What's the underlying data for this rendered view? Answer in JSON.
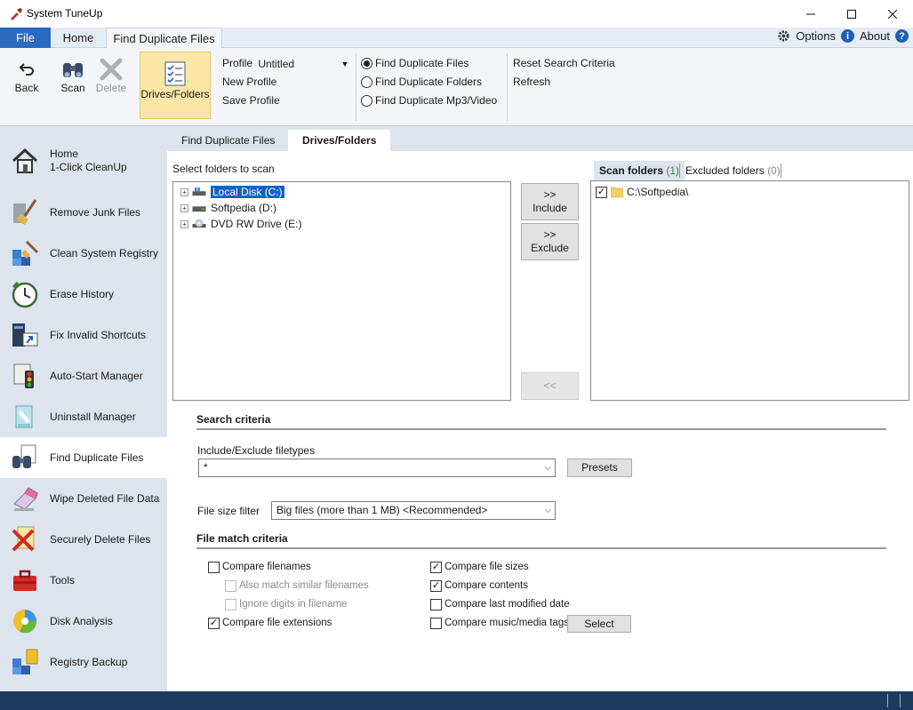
{
  "window": {
    "title": "System TuneUp"
  },
  "menu": {
    "file": "File",
    "home": "Home",
    "active_tab": "Find Duplicate Files",
    "options": "Options",
    "about": "About"
  },
  "ribbon": {
    "back": "Back",
    "scan": "Scan",
    "delete": "Delete",
    "drives_folders": "Drives/Folders",
    "profile_label": "Profile",
    "profile_value": "Untitled",
    "new_profile": "New Profile",
    "save_profile": "Save Profile",
    "radio_options": [
      "Find Duplicate Files",
      "Find Duplicate Folders",
      "Find Duplicate Mp3/Video"
    ],
    "reset": "Reset Search Criteria",
    "refresh": "Refresh"
  },
  "sidebar": {
    "items": [
      {
        "label": "Home",
        "label2": "1-Click CleanUp"
      },
      {
        "label": "Remove Junk Files"
      },
      {
        "label": "Clean System Registry"
      },
      {
        "label": "Erase History"
      },
      {
        "label": "Fix Invalid Shortcuts"
      },
      {
        "label": "Auto-Start Manager"
      },
      {
        "label": "Uninstall Manager"
      },
      {
        "label": "Find Duplicate Files"
      },
      {
        "label": "Wipe Deleted File Data"
      },
      {
        "label": "Securely Delete Files"
      },
      {
        "label": "Tools"
      },
      {
        "label": "Disk Analysis"
      },
      {
        "label": "Registry Backup"
      }
    ]
  },
  "subtabs": [
    "Find Duplicate Files",
    "Drives/Folders"
  ],
  "folders": {
    "select_label": "Select folders to scan",
    "tree": [
      "Local Disk (C:)",
      "Softpedia (D:)",
      "DVD RW Drive (E:)"
    ],
    "include_arrows": ">>",
    "include": "Include",
    "exclude_arrows": ">>",
    "exclude": "Exclude",
    "remove": "<<",
    "scan_tab": "Scan folders",
    "scan_count": "(1)",
    "excluded_tab": "Excluded folders",
    "excluded_count": "(0)",
    "scan_list": [
      "C:\\Softpedia\\"
    ]
  },
  "search": {
    "title": "Search criteria",
    "filetypes_label": "Include/Exclude filetypes",
    "filetypes_value": "*",
    "presets": "Presets",
    "size_label": "File size filter",
    "size_value": "Big files (more than 1 MB) <Recommended>"
  },
  "match": {
    "title": "File match criteria",
    "compare_filenames": "Compare filenames",
    "similar_filenames": "Also match similar filenames",
    "ignore_digits": "Ignore digits in filename",
    "compare_extensions": "Compare file extensions",
    "compare_sizes": "Compare file sizes",
    "compare_contents": "Compare contents",
    "compare_modified": "Compare last modified date",
    "compare_music": "Compare music/media tags",
    "select": "Select"
  }
}
